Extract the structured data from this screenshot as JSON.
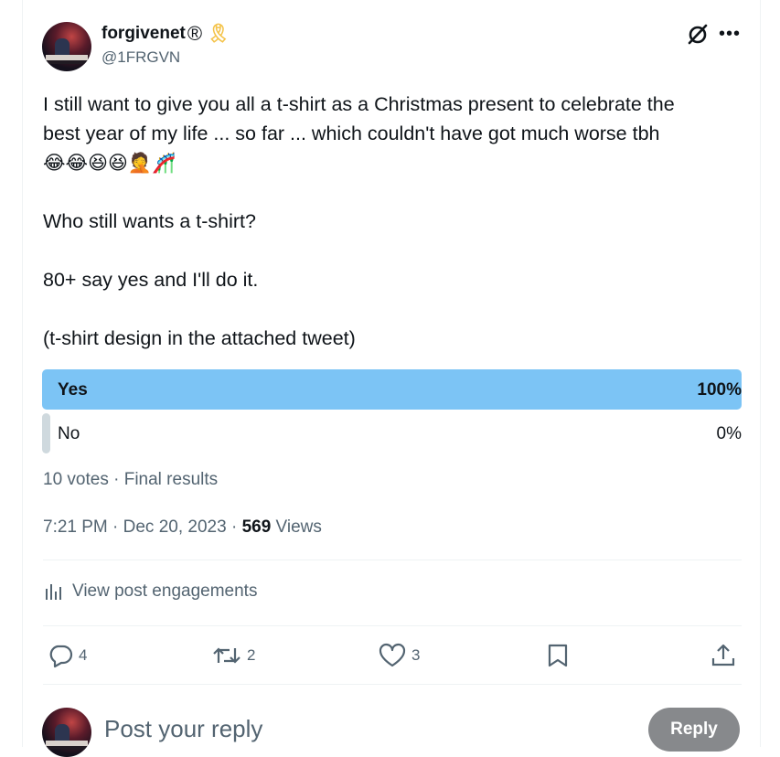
{
  "post": {
    "author_name": "forgivenet",
    "registered_mark": "®",
    "ribbon_emoji": "🎗",
    "handle": "@1FRGVN",
    "text_lines": [
      "I still want to give you all a t-shirt as a Christmas present to celebrate the",
      "best year of my life ... so far ... which couldn't have got much worse tbh"
    ],
    "emoji_line": "😂😂😆😆🤦🎢",
    "text_question": "Who still wants a t-shirt?",
    "text_condition": "80+ say yes and I'll do it.",
    "text_note": "(t-shirt design in the attached tweet)"
  },
  "poll": {
    "options": [
      {
        "label": "Yes",
        "percent_text": "100%",
        "fraction": 1.0
      },
      {
        "label": "No",
        "percent_text": "0%",
        "fraction": 0.0
      }
    ],
    "summary": "10 votes · Final results"
  },
  "timestamp": {
    "time_date": "7:21 PM · Dec 20, 2023 · ",
    "views_count": "569",
    "views_label": " Views"
  },
  "engagements_label": "View post engagements",
  "actions": {
    "replies": "4",
    "reposts": "2",
    "likes": "3"
  },
  "reply_box": {
    "placeholder": "Post your reply",
    "button_label": "Reply"
  },
  "colors": {
    "winning_bar": "#7cc4f5",
    "losing_bar": "#cfd9de",
    "secondary_text": "#536471",
    "reply_button": "#87898c"
  },
  "icons": [
    "grok-icon",
    "more-icon",
    "analytics-icon",
    "reply-icon",
    "repost-icon",
    "like-icon",
    "bookmark-icon",
    "share-icon"
  ]
}
